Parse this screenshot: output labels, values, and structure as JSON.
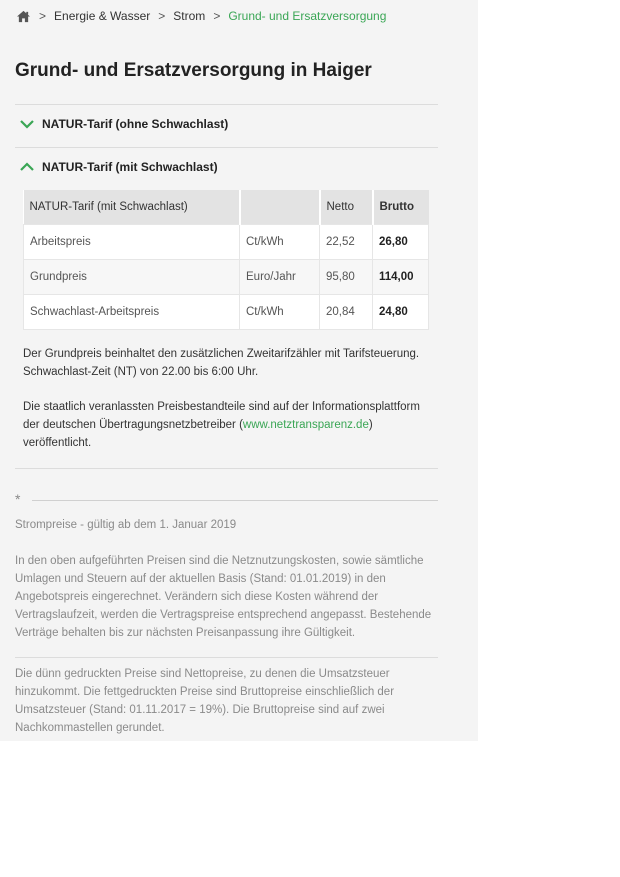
{
  "breadcrumb": {
    "home_icon": "home-icon",
    "items": [
      "Energie & Wasser",
      "Strom",
      "Grund- und Ersatzversorgung"
    ],
    "separator": ">",
    "active_color": "#3aa655"
  },
  "page_title": "Grund- und Ersatzversorgung in Haiger",
  "accordion": [
    {
      "label": "NATUR-Tarif (ohne Schwachlast)",
      "state": "collapsed",
      "icon": "chevron-down-icon"
    },
    {
      "label": "NATUR-Tarif (mit Schwachlast)",
      "state": "expanded",
      "icon": "chevron-up-icon"
    }
  ],
  "table": {
    "headers": [
      "NATUR-Tarif (mit Schwachlast)",
      "",
      "Netto",
      "Brutto"
    ],
    "rows": [
      {
        "name": "Arbeitspreis",
        "unit": "Ct/kWh",
        "netto": "22,52",
        "brutto": "26,80"
      },
      {
        "name": "Grundpreis",
        "unit": "Euro/Jahr",
        "netto": "95,80",
        "brutto": "114,00"
      },
      {
        "name": "Schwachlast-Arbeitspreis",
        "unit": "Ct/kWh",
        "netto": "20,84",
        "brutto": "24,80"
      }
    ]
  },
  "info": {
    "p1": "Der Grundpreis beinhaltet den zusätzlichen Zweitarifzähler mit Tarifsteuerung. Schwachlast-Zeit (NT) von 22.00 bis 6:00 Uhr.",
    "p2_before": "Die staatlich veranlassten Preisbestandteile sind auf der Informationsplattform der deutschen Übertragungsnetzbetreiber (",
    "p2_link": "www.netztransparenz.de",
    "p2_after": ") veröffentlicht."
  },
  "footnote": {
    "star": "*",
    "validity": "Strompreise - gültig ab dem 1. Januar 2019",
    "p1": "In den oben aufgeführten Preisen sind die Netznutzungskosten, sowie sämtliche Umlagen und Steuern auf der aktuellen Basis (Stand: 01.01.2019) in den Angebotspreis eingerechnet. Verändern sich diese Kosten während der Vertragslaufzeit, werden die Vertragspreise entsprechend angepasst. Bestehende Verträge behalten bis zur nächsten Preisanpassung ihre Gültigkeit.",
    "p2": "Die dünn gedruckten Preise sind Nettopreise, zu denen die Umsatzsteuer hinzukommt. Die fettgedruckten Preise sind Bruttopreise einschließlich der Umsatzsteuer (Stand: 01.11.2017 = 19%). Die Bruttopreise sind auf zwei Nachkommastellen gerundet."
  }
}
